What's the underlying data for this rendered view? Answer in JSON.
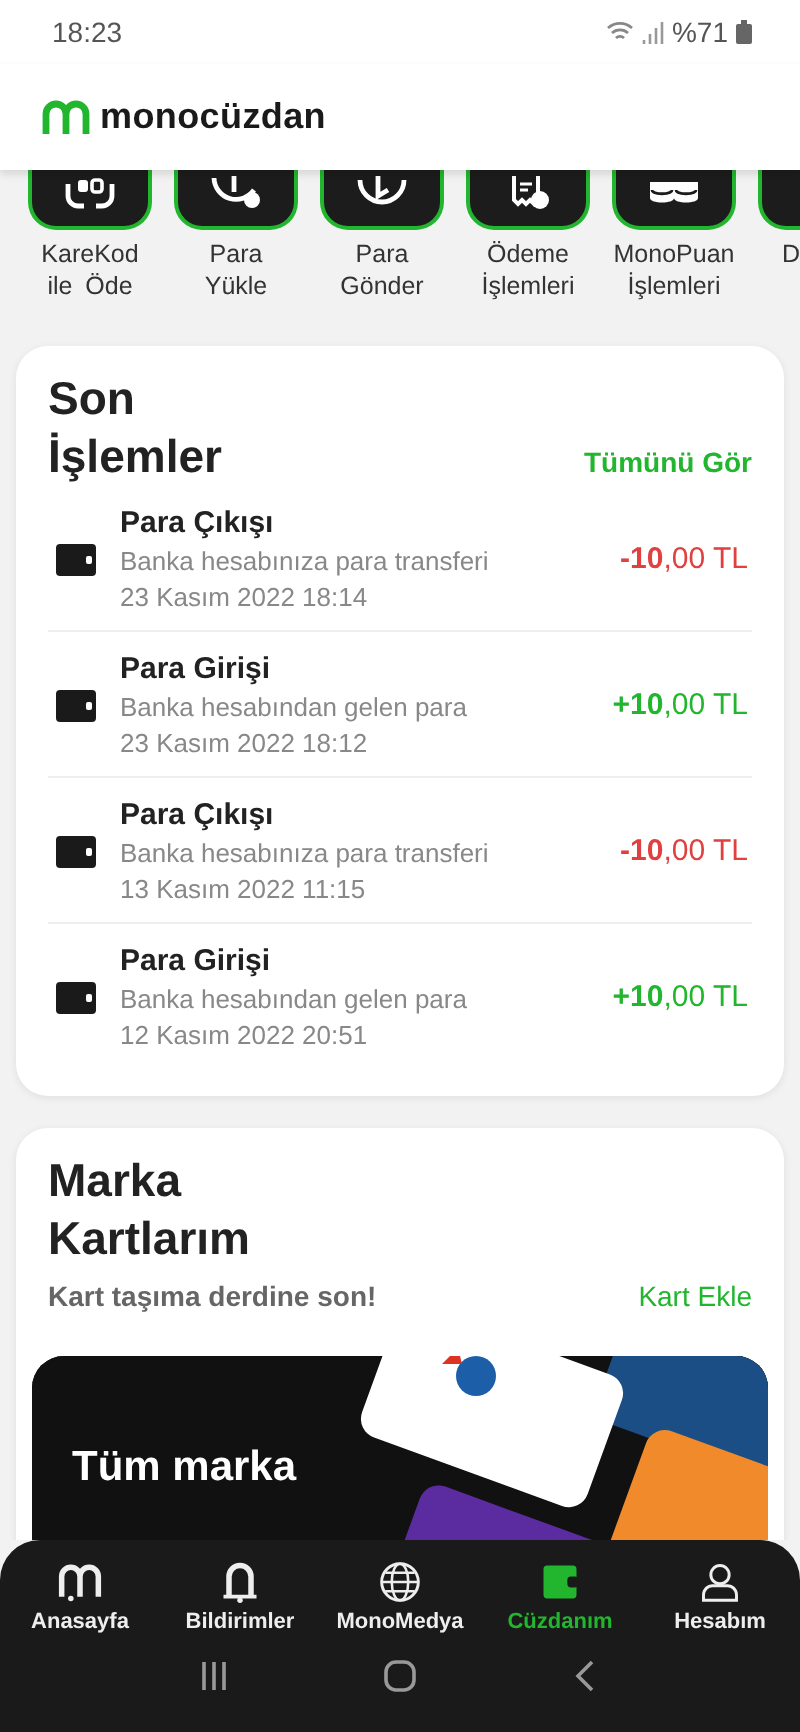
{
  "status_bar": {
    "time": "18:23",
    "battery": "%71"
  },
  "header": {
    "brand": "monocüzdan"
  },
  "quick_actions": [
    {
      "label": "KareKod ile Öde",
      "kind": "qr"
    },
    {
      "label": "Para Yükle",
      "kind": "load"
    },
    {
      "label": "Para Gönder",
      "kind": "send"
    },
    {
      "label": "Ödeme İşlemleri",
      "kind": "bill"
    },
    {
      "label": "MonoPuan İşlemleri",
      "kind": "coins"
    },
    {
      "label": "D",
      "kind": "other"
    }
  ],
  "recent": {
    "title": "Son İşlemler",
    "link": "Tümünü Gör",
    "transactions": [
      {
        "title": "Para Çıkışı",
        "description": "Banka hesabınıza para transferi",
        "date": "23 Kasım 2022 18:14",
        "amount": "**-10**,00 TL",
        "kind": "out"
      },
      {
        "title": "Para Girişi",
        "description": "Banka hesabından gelen para",
        "date": "23 Kasım 2022 18:12",
        "amount": "**+10**,00 TL",
        "kind": "in"
      },
      {
        "title": "Para Çıkışı",
        "description": "Banka hesabınıza para transferi",
        "date": "13 Kasım 2022 11:15",
        "amount": "**-10**,00 TL",
        "kind": "out"
      },
      {
        "title": "Para Girişi",
        "description": "Banka hesabından gelen para",
        "date": "12 Kasım 2022 20:51",
        "amount": "**+10**,00 TL",
        "kind": "in"
      }
    ]
  },
  "brand_cards": {
    "title": "Marka Kartlarım",
    "subtitle": "Kart taşıma derdine son!",
    "link": "Kart Ekle",
    "banner": {
      "kind": "picture",
      "text": "Tüm marka"
    }
  },
  "bottom_nav": [
    {
      "label": "Anasayfa",
      "kind": "home",
      "selected": false
    },
    {
      "label": "Bildirimler",
      "kind": "bell",
      "selected": false
    },
    {
      "label": "MonoMedya",
      "kind": "globe",
      "selected": false
    },
    {
      "label": "Cüzdanım",
      "kind": "wallet",
      "selected": true
    },
    {
      "label": "Hesabım",
      "kind": "user",
      "selected": false
    }
  ]
}
